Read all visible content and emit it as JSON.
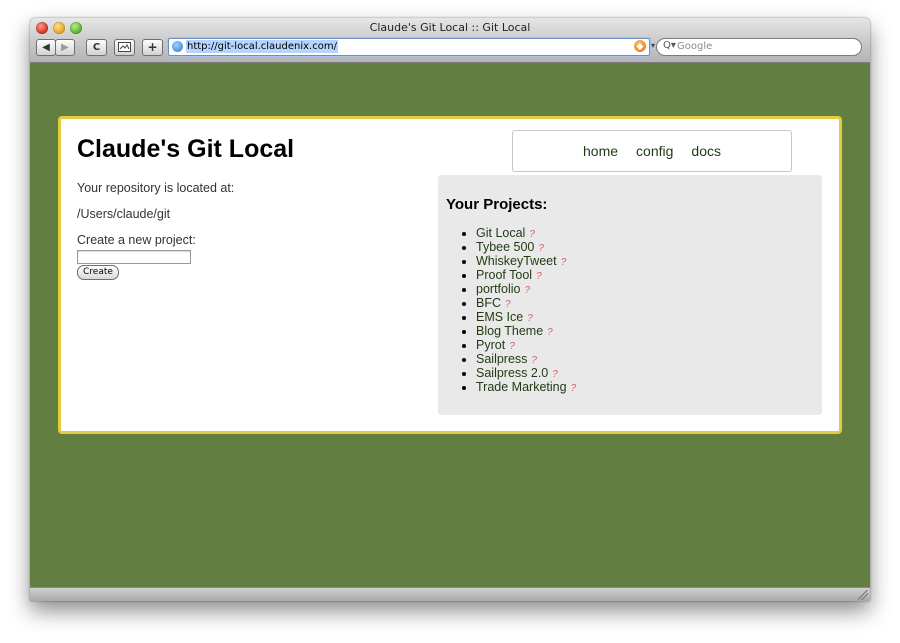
{
  "browser": {
    "window_title": "Claude's Git Local :: Git Local",
    "back_icon": "◀",
    "forward_icon": "▶",
    "reload_icon": "C",
    "add_icon": "+",
    "url": "http://git-local.claudenix.com/",
    "search_placeholder": "Google",
    "search_glyph": "Q▾"
  },
  "page": {
    "site_title": "Claude's Git Local",
    "nav": [
      {
        "label": "home"
      },
      {
        "label": "config"
      },
      {
        "label": "docs"
      }
    ],
    "repo_label": "Your repository is located at:",
    "repo_path": "/Users/claude/git",
    "create_label": "Create a new project:",
    "create_input_value": "",
    "create_button": "Create",
    "projects_heading": "Your Projects:",
    "help_marker": "?",
    "projects": [
      {
        "name": "Git Local"
      },
      {
        "name": "Tybee 500"
      },
      {
        "name": "WhiskeyTweet"
      },
      {
        "name": "Proof Tool"
      },
      {
        "name": "portfolio"
      },
      {
        "name": "BFC"
      },
      {
        "name": "EMS Ice"
      },
      {
        "name": "Blog Theme"
      },
      {
        "name": "Pyrot"
      },
      {
        "name": "Sailpress"
      },
      {
        "name": "Sailpress 2.0"
      },
      {
        "name": "Trade Marketing"
      }
    ]
  },
  "colors": {
    "page_background": "#627f41",
    "card_border": "#e7cb3f",
    "panel_background": "#e9e9e9",
    "link": "#1f3a12",
    "help_marker": "#d4606a"
  }
}
